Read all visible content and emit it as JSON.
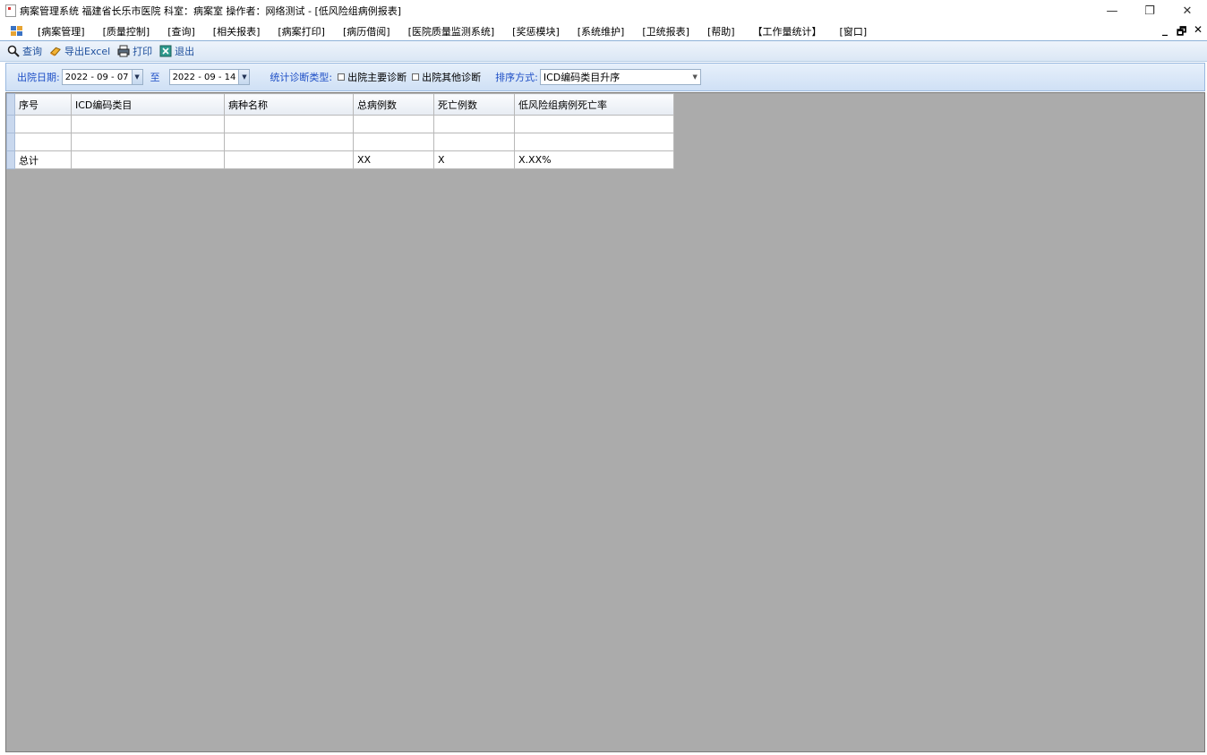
{
  "window": {
    "title": "病案管理系统 福建省长乐市医院 科室：病案室 操作者：网络测试 - [低风险组病例报表]",
    "controls": {
      "minimize": "—",
      "restore": "❐",
      "close": "✕"
    }
  },
  "menubar": {
    "items": [
      "[病案管理]",
      "[质量控制]",
      "[查询]",
      "[相关报表]",
      "[病案打印]",
      "[病历借阅]",
      "[医院质量监测系统]",
      "[奖惩模块]",
      "[系统维护]",
      "[卫统报表]",
      "[帮助]",
      "【工作量统计】",
      "[窗口]"
    ],
    "mdi": {
      "minimize": "_",
      "restore": "🗗",
      "close": "✕"
    }
  },
  "toolbar": {
    "query": "查询",
    "export": "导出Excel",
    "print": "打印",
    "exit": "退出"
  },
  "filters": {
    "date_label": "出院日期:",
    "date_from": "2022 - 09 - 07",
    "to_label": "至",
    "date_to": "2022 - 09 - 14",
    "diag_type_label": "统计诊断类型:",
    "main_diag": "出院主要诊断",
    "other_diag": "出院其他诊断",
    "sort_label": "排序方式:",
    "sort_value": "ICD编码类目升序"
  },
  "table": {
    "columns": [
      "序号",
      "ICD编码类目",
      "病种名称",
      "总病例数",
      "死亡例数",
      "低风险组病例死亡率"
    ],
    "rows": [
      [
        "",
        "",
        "",
        "",
        "",
        ""
      ],
      [
        "",
        "",
        "",
        "",
        "",
        ""
      ],
      [
        "总计",
        "",
        "",
        "XX",
        "X",
        "X.XX%"
      ]
    ]
  },
  "colors": {
    "toolbar_text": "#1e4f9c",
    "filter_label": "#1e4fc6",
    "grid_background": "#ababab"
  }
}
